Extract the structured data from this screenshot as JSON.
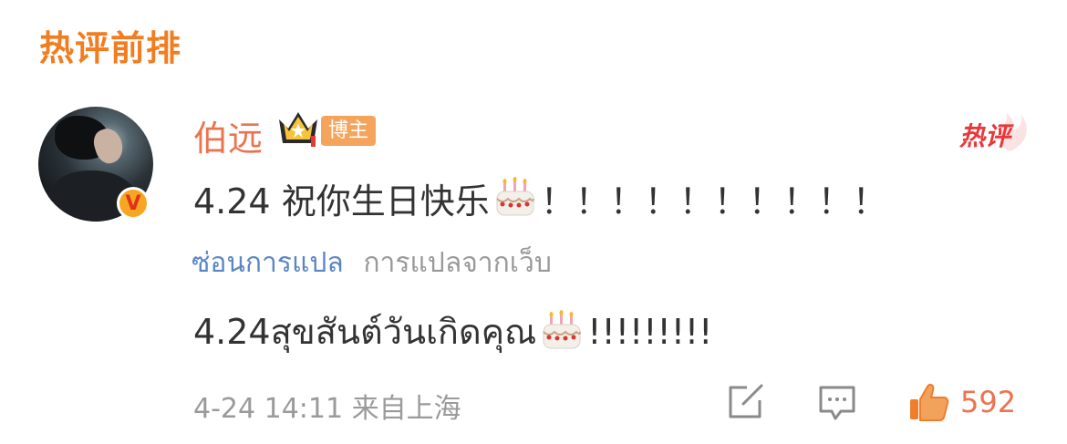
{
  "section": {
    "title": "热评前排"
  },
  "comment": {
    "username": "伯远",
    "host_badge": "博主",
    "hot_label": "热评",
    "verified_mark": "V",
    "text_before": "4.24 祝你生日快乐",
    "text_after": "！！！！！！！！！！",
    "translate": {
      "hide_label": "ซ่อนการแปล",
      "source_label": "การแปลจากเว็บ"
    },
    "translated_before": "4.24สุขสันต์วันเกิดคุณ",
    "translated_after": "!!!!!!!!!",
    "timestamp": "4-24 14:11",
    "location": "来自上海",
    "likes": "592",
    "icons": {
      "avatar": "avatar-image",
      "crown": "crown-icon",
      "cake": "birthday-cake-icon",
      "share": "share-icon",
      "reply": "comment-icon",
      "like": "thumbs-up-icon"
    }
  },
  "colors": {
    "accent": "#f17d20",
    "username": "#eb7350",
    "link": "#5b86c5",
    "muted": "#999999",
    "hot": "#e9373a"
  }
}
